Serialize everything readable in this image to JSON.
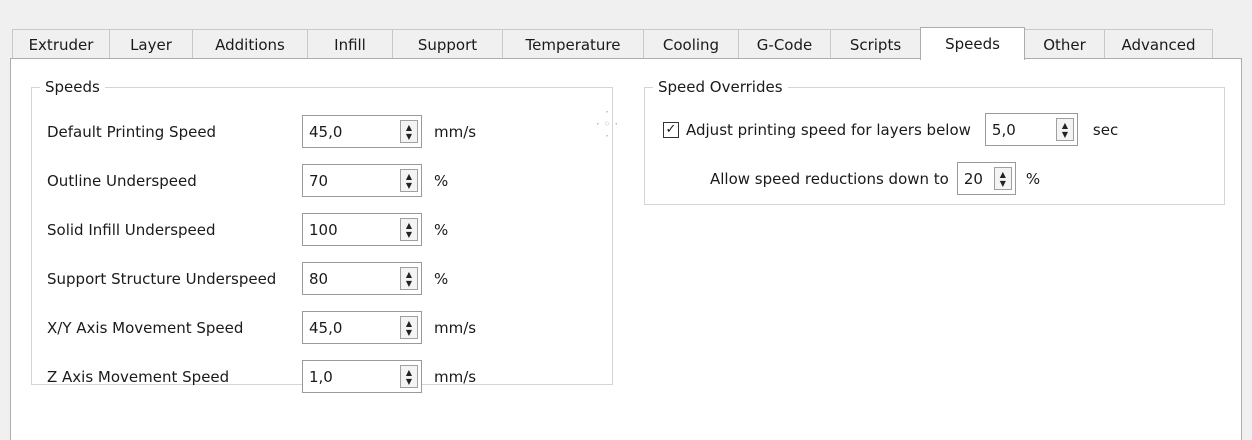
{
  "tabs": [
    {
      "label": "Extruder"
    },
    {
      "label": "Layer"
    },
    {
      "label": "Additions"
    },
    {
      "label": "Infill"
    },
    {
      "label": "Support"
    },
    {
      "label": "Temperature"
    },
    {
      "label": "Cooling"
    },
    {
      "label": "G-Code"
    },
    {
      "label": "Scripts"
    },
    {
      "label": "Speeds"
    },
    {
      "label": "Other"
    },
    {
      "label": "Advanced"
    }
  ],
  "active_tab": "Speeds",
  "speeds_group": {
    "title": "Speeds",
    "rows": [
      {
        "label": "Default Printing Speed",
        "value": "45,0",
        "unit": "mm/s"
      },
      {
        "label": "Outline Underspeed",
        "value": "70",
        "unit": "%"
      },
      {
        "label": "Solid Infill Underspeed",
        "value": "100",
        "unit": "%"
      },
      {
        "label": "Support Structure Underspeed",
        "value": "80",
        "unit": "%"
      },
      {
        "label": "X/Y Axis Movement Speed",
        "value": "45,0",
        "unit": "mm/s"
      },
      {
        "label": "Z Axis Movement Speed",
        "value": "1,0",
        "unit": "mm/s"
      }
    ]
  },
  "overrides_group": {
    "title": "Speed Overrides",
    "adjust_checkbox": {
      "label": "Adjust printing speed for layers below",
      "checked": true,
      "value": "5,0",
      "unit": "sec"
    },
    "reduction": {
      "label": "Allow speed reductions down to",
      "value": "20",
      "unit": "%"
    }
  },
  "icons": {
    "spin": "spinner-arrows-icon",
    "check": "checkmark-icon"
  }
}
